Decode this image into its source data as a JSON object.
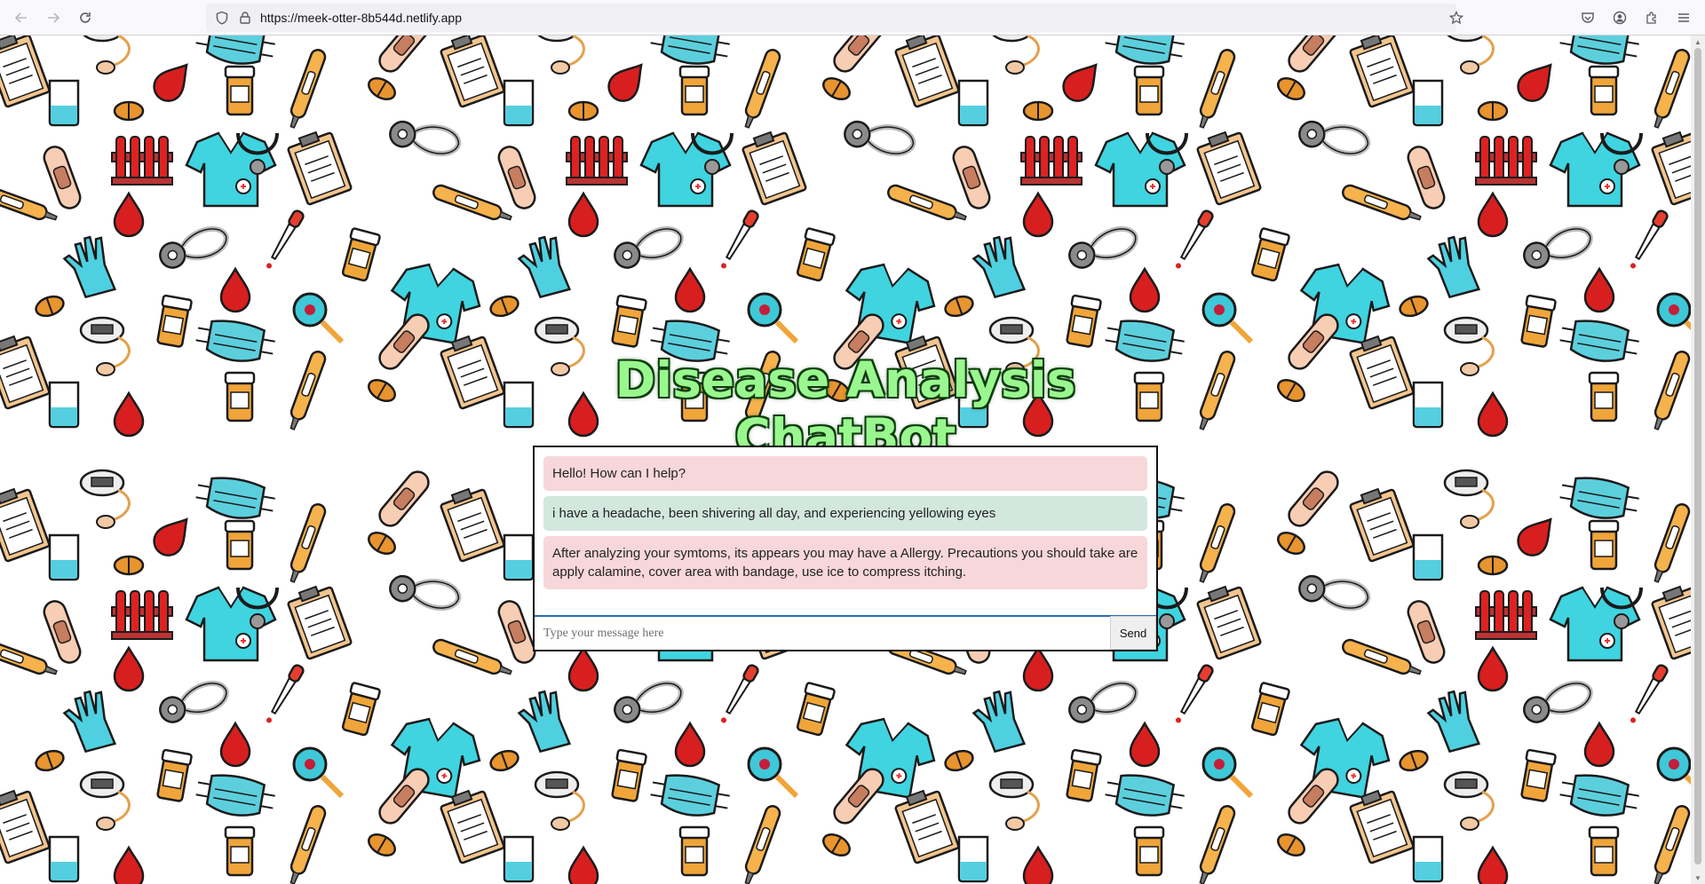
{
  "browser": {
    "url": "https://meek-otter-8b544d.netlify.app",
    "nav_back_icon": "back-arrow-icon",
    "nav_forward_icon": "forward-arrow-icon",
    "reload_icon": "reload-icon",
    "shield_icon": "shield-icon",
    "lock_icon": "lock-icon",
    "bookmark_icon": "star-icon",
    "pocket_icon": "pocket-icon",
    "account_icon": "account-icon",
    "extensions_icon": "extensions-icon",
    "menu_icon": "hamburger-menu-icon"
  },
  "chat": {
    "title": "Disease Analysis ChatBot",
    "messages": [
      {
        "role": "bot",
        "text": "Hello! How can I help?"
      },
      {
        "role": "user",
        "text": "i have a headache, been shivering all day, and experiencing yellowing eyes"
      },
      {
        "role": "bot",
        "text": "After analyzing your symtoms, its appears you may have a Allergy. Precautions you should take are apply calamine, cover area with bandage, use ice to compress itching."
      }
    ],
    "input_placeholder": "Type your message here",
    "input_value": "",
    "send_label": "Send"
  },
  "theme": {
    "title_fill": "#9af78f",
    "title_outline": "#0a3d0a",
    "bot_bubble": "#f7d7da",
    "user_bubble": "#d2e7de",
    "input_focus_border": "#2a6cb7"
  },
  "background_pattern_icons": [
    "medical-scrubs-icon",
    "stethoscope-icon",
    "surgical-mask-icon",
    "bandage-icon",
    "clipboard-icon",
    "thermometer-icon",
    "test-tube-rack-icon",
    "pill-icon",
    "blood-drop-icon",
    "gloves-icon",
    "dropper-icon",
    "beaker-icon",
    "pill-bottle-icon",
    "magnifier-icon",
    "blood-pressure-monitor-icon",
    "head-mirror-icon"
  ]
}
